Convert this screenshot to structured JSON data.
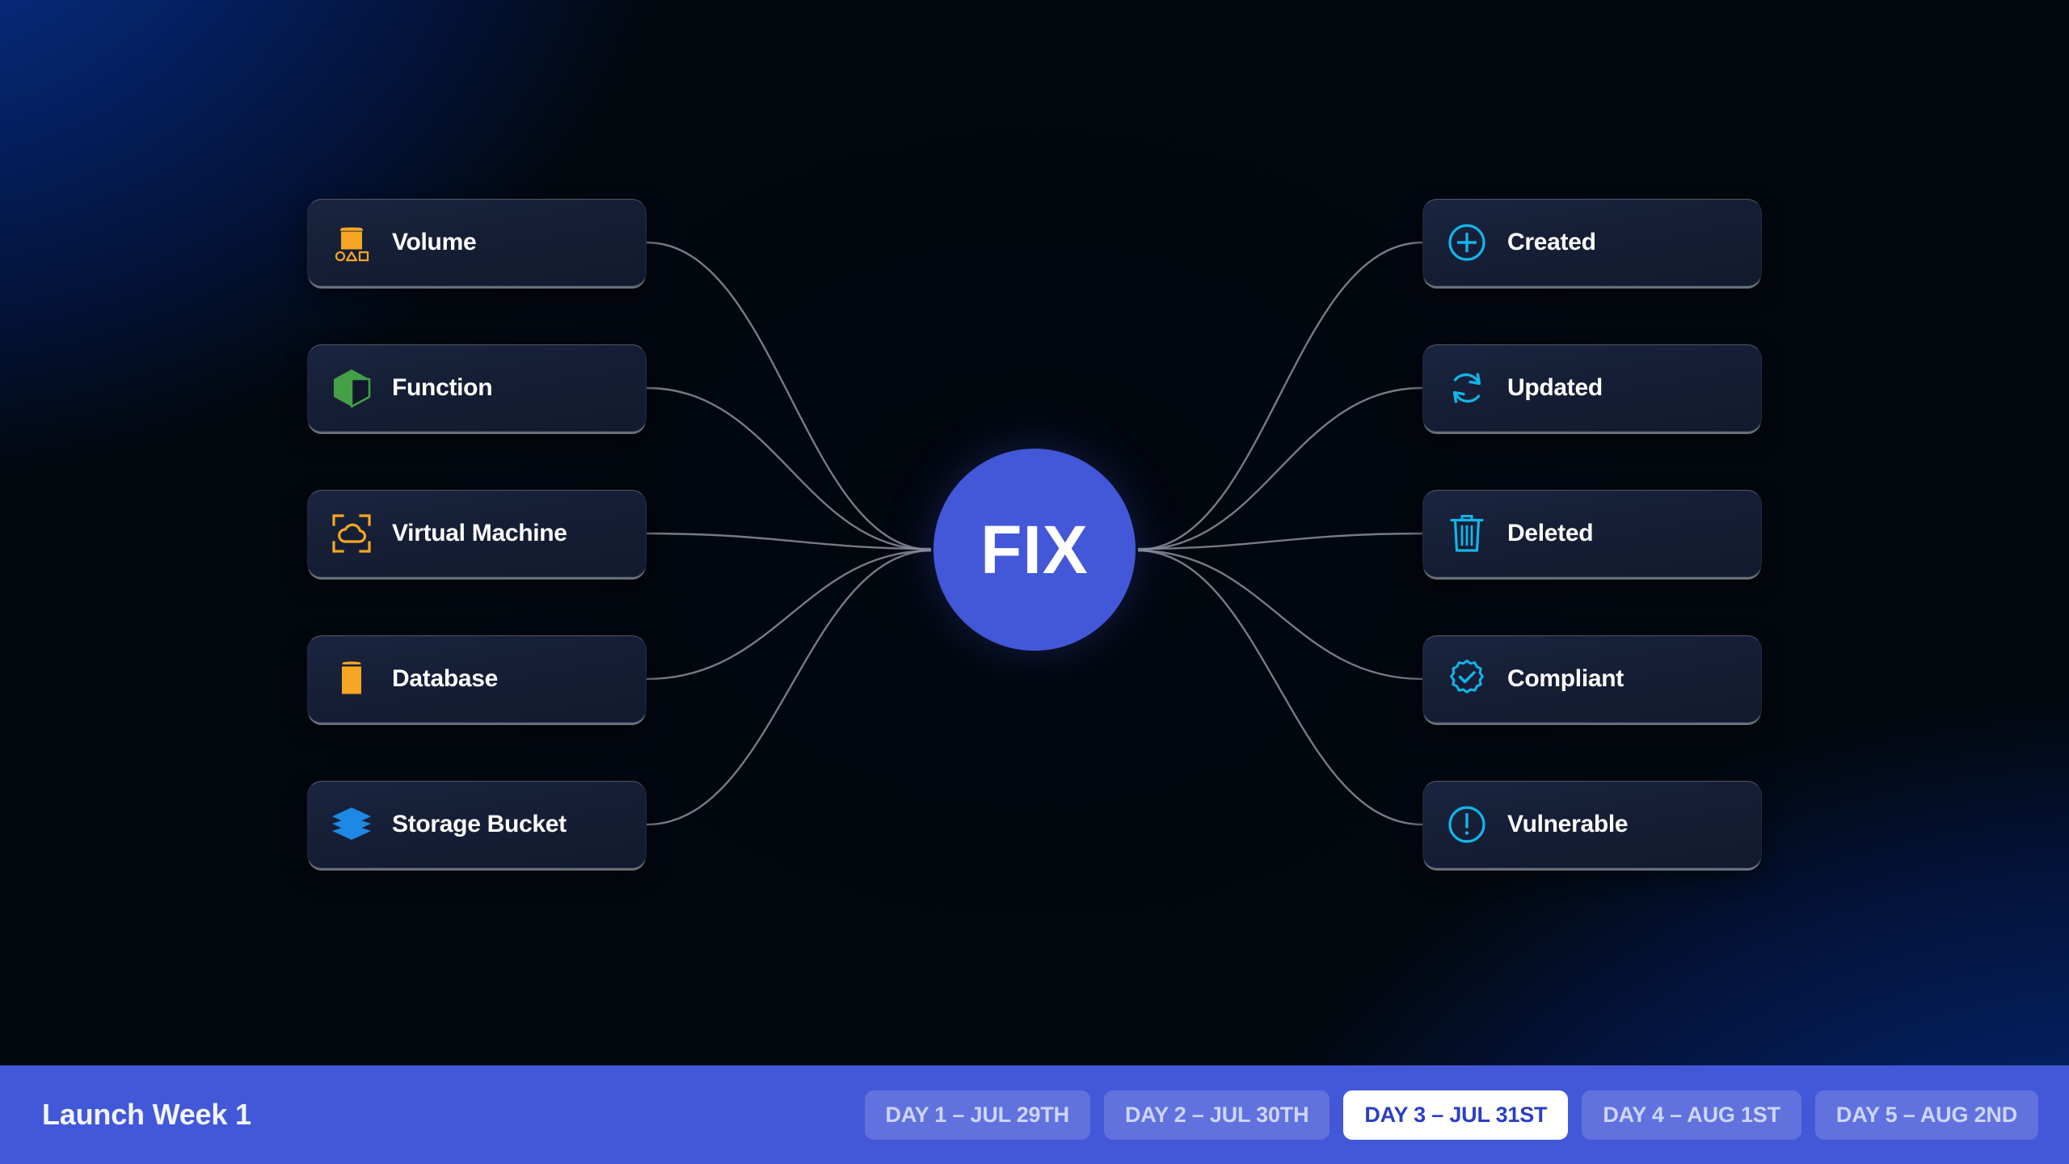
{
  "hub": {
    "label": "FIX",
    "color": "#4358d8"
  },
  "colors": {
    "accent": "#4358d8",
    "cyan": "#13b5ea",
    "orange": "#f5a623",
    "green": "#43a047",
    "blue": "#1e88e5",
    "card_bg": "#151f35",
    "connector": "#8b909a"
  },
  "left_cards": [
    {
      "label": "Volume",
      "icon": "volume-icon",
      "color": "#f5a623"
    },
    {
      "label": "Function",
      "icon": "function-cube-icon",
      "color": "#43a047"
    },
    {
      "label": "Virtual Machine",
      "icon": "virtual-machine-icon",
      "color": "#f5a623"
    },
    {
      "label": "Database",
      "icon": "database-icon",
      "color": "#f5a623"
    },
    {
      "label": "Storage Bucket",
      "icon": "storage-layers-icon",
      "color": "#1e88e5"
    }
  ],
  "right_cards": [
    {
      "label": "Created",
      "icon": "plus-circle-icon",
      "color": "#13b5ea"
    },
    {
      "label": "Updated",
      "icon": "refresh-icon",
      "color": "#13b5ea"
    },
    {
      "label": "Deleted",
      "icon": "trash-icon",
      "color": "#13b5ea"
    },
    {
      "label": "Compliant",
      "icon": "badge-check-icon",
      "color": "#13b5ea"
    },
    {
      "label": "Vulnerable",
      "icon": "alert-circle-icon",
      "color": "#13b5ea"
    }
  ],
  "footer": {
    "title": "Launch Week 1",
    "tabs": [
      {
        "label": "DAY 1 – JUL 29TH",
        "active": false
      },
      {
        "label": "DAY 2 – JUL 30TH",
        "active": false
      },
      {
        "label": "DAY 3 – JUL 31ST",
        "active": true
      },
      {
        "label": "DAY 4 – AUG 1ST",
        "active": false
      },
      {
        "label": "DAY 5 – AUG 2ND",
        "active": false
      }
    ]
  }
}
